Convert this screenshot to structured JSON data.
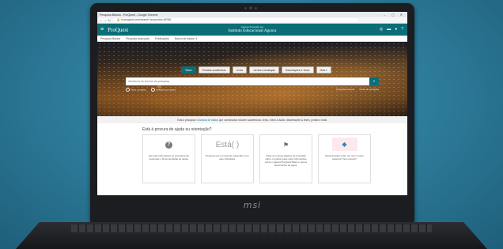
{
  "browser": {
    "tab_title": "Pesquisa Básica - ProQuest - Google Chrome",
    "window_controls": "–  ▢  ✕",
    "url": "m.proquest.com/search?accountid=48788",
    "url_icon": "lock-icon"
  },
  "header": {
    "logo": "ProQuest",
    "institution_small": "Acesso fornecido por",
    "institution": "Instituto Educacional Agoura",
    "menu_icon": "hamburger-icon",
    "icons": [
      "globe-icon",
      "folder-icon",
      "user-icon",
      "help-icon"
    ]
  },
  "subnav": [
    "Pesquisa Básica",
    "Pesquisa avançada",
    "Publicações",
    "Banco de dados: 4"
  ],
  "search": {
    "tabs": [
      "Todos",
      "Revistas acadêmicas",
      "Livros",
      "Jornais & Avaliação",
      "Dissertações & Teses",
      "Mais ▾"
    ],
    "active_tab_index": 0,
    "placeholder": "Introduza os termos da pesquisa",
    "search_icon": "search-icon",
    "option_left_1": "Texto completo",
    "option_left_2": "Avaliado por pares",
    "option_right_1": "Pesquisa recente",
    "option_right_2": "Dicas de pesquisa"
  },
  "info": {
    "before": "Está a pesquisar",
    "link": "4 bancos de dados",
    "after": "que combinados incluem académicas, livros, vídeo & áudio, dissertações & teses, jornais e mais."
  },
  "help": {
    "title": "Está à procura de ajuda ou orientação?",
    "cards": [
      {
        "icon": "question-circle-icon",
        "text": "Há mais informações no procedimento pesquisar o Documentação de ajuda."
      },
      {
        "icon_text": "Está( )",
        "text": "Pesquise por um assunto específico com este LibGuides."
      },
      {
        "icon": "signpost-icon",
        "text": "Visite as nossas páginas de formação sobre o produto para mais informações sobre o página ProQuest Basic e outros documentos de apoio."
      },
      {
        "icon": "box-icon",
        "text": "Ainda dúvidas sobre um termo sobre estamos? Isso estudo?"
      }
    ]
  },
  "laptop": {
    "brand": "msi"
  }
}
